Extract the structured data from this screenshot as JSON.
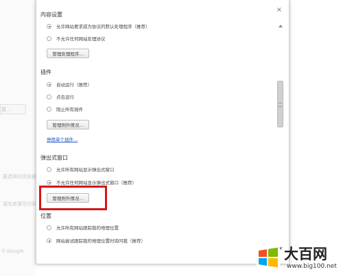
{
  "dialog": {
    "close_glyph": "×",
    "sections": [
      {
        "heading": "内容设置",
        "options": [
          {
            "label": "允许网站要求成为协议的默认处理程序（推荐）",
            "checked": true
          },
          {
            "label": "不允许任何网站处理协议",
            "checked": false
          }
        ],
        "button": "管理处理程序..."
      },
      {
        "heading": "插件",
        "options": [
          {
            "label": "自动运行（推荐）",
            "checked": true
          },
          {
            "label": "点击运行",
            "checked": false
          },
          {
            "label": "阻止所有插件",
            "checked": false
          }
        ],
        "button": "管理例外情况...",
        "link": "停用单个插件..."
      },
      {
        "heading": "弹出式窗口",
        "options": [
          {
            "label": "允许所有网站显示弹出式窗口",
            "checked": false
          },
          {
            "label": "不允许任何网站显示弹出式窗口（推荐）",
            "checked": true
          }
        ],
        "button": "管理例外情况..."
      },
      {
        "heading": "位置",
        "options": [
          {
            "label": "允许所有网站跟踪我的地理位置",
            "checked": false
          },
          {
            "label": "网站尝试跟踪我的地理位置时询问我（推荐）",
            "checked": true
          }
        ]
      }
    ]
  },
  "background": {
    "text_1": "置...",
    "text_2": "要选择的浏览器",
    "text_3": "填充单填写内容",
    "text_4": "Google"
  },
  "watermark": {
    "title": "大百网",
    "subtitle": "www.big100.net",
    "icon": "windows-logo-icon"
  },
  "colors": {
    "highlight": "#d41616",
    "link": "#1f55c4"
  }
}
